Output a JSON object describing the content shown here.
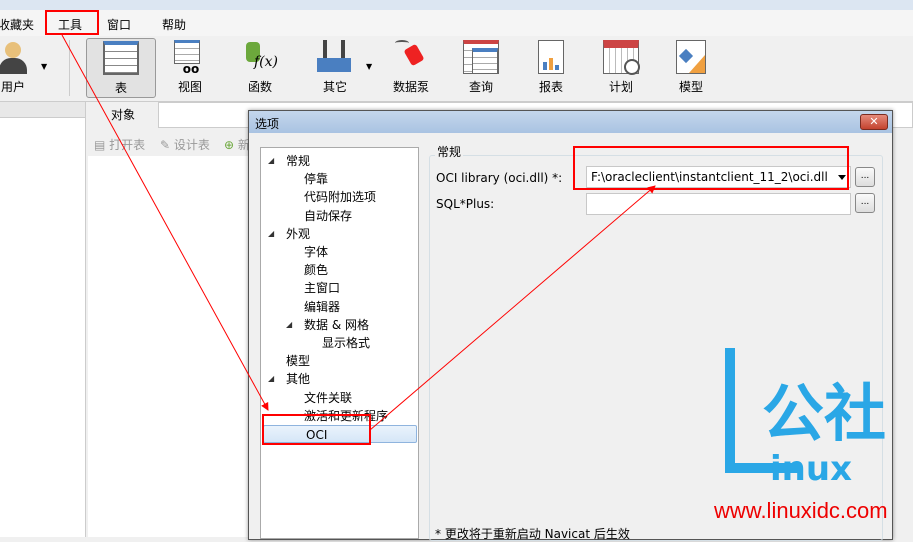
{
  "menu": [
    "收藏夹",
    "工具",
    "窗口",
    "帮助"
  ],
  "toolbar": {
    "user": "用户",
    "items": [
      "表",
      "视图",
      "函数",
      "其它",
      "数据泵",
      "查询",
      "报表",
      "计划",
      "模型"
    ]
  },
  "objects": {
    "tab": "对象",
    "tools": [
      "打开表",
      "设计表",
      "新"
    ]
  },
  "dialog": {
    "title": "选项",
    "close": "✕",
    "tree": [
      {
        "label": "常规",
        "level": 0,
        "expanded": true
      },
      {
        "label": "停靠",
        "level": 1
      },
      {
        "label": "代码附加选项",
        "level": 1
      },
      {
        "label": "自动保存",
        "level": 1
      },
      {
        "label": "外观",
        "level": 0,
        "expanded": true
      },
      {
        "label": "字体",
        "level": 1
      },
      {
        "label": "颜色",
        "level": 1
      },
      {
        "label": "主窗口",
        "level": 1
      },
      {
        "label": "编辑器",
        "level": 1
      },
      {
        "label": "数据 & 网格",
        "level": 1,
        "expanded": true
      },
      {
        "label": "显示格式",
        "level": 2
      },
      {
        "label": "模型",
        "level": 0
      },
      {
        "label": "其他",
        "level": 0,
        "expanded": true
      },
      {
        "label": "文件关联",
        "level": 1
      },
      {
        "label": "激活和更新程序",
        "level": 1
      },
      {
        "label": "OCI",
        "level": 1,
        "selected": true
      }
    ],
    "group_title": "常规",
    "oci_label": "OCI library (oci.dll) *:",
    "oci_value": "F:\\oracleclient\\instantclient_11_2\\oci.dll",
    "sqlplus_label": "SQL*Plus:",
    "sqlplus_value": "",
    "browse": "...",
    "note": "* 更改将于重新启动 Navicat 后生效"
  },
  "watermark": {
    "brand": "Linux公社",
    "url": "www.linuxidc.com"
  },
  "colors": {
    "annotation": "#ff0000",
    "watermark": "#2aa7e6"
  }
}
